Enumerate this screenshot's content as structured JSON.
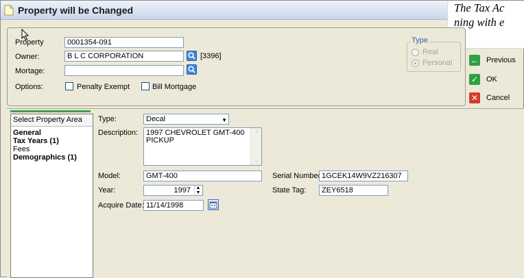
{
  "window": {
    "title": "Property will be Changed"
  },
  "caption": {
    "line1": "The Tax Ac",
    "line2": "ning with e"
  },
  "header": {
    "property_label": "Property",
    "property_value": "0001354-091",
    "owner_label": "Owner:",
    "owner_value": "B L C CORPORATION",
    "owner_code": "[3396]",
    "mortgage_label": "Mortage:",
    "mortgage_value": "",
    "options_label": "Options:",
    "penalty_exempt_label": "Penalty Exempt",
    "bill_mortgage_label": "Bill Mortgage"
  },
  "type_group": {
    "legend": "Type",
    "real_label": "Real",
    "personal_label": "Personal",
    "selected": "Personal"
  },
  "actions": {
    "previous_label": "Previous",
    "ok_label": "OK",
    "cancel_label": "Cancel"
  },
  "area_list": {
    "header": "Select Property Area",
    "items": [
      {
        "label": "General",
        "bold": true
      },
      {
        "label": "Tax Years (1)",
        "bold": true
      },
      {
        "label": "Fees",
        "bold": false
      },
      {
        "label": "Demographics (1)",
        "bold": true
      }
    ]
  },
  "detail": {
    "type_label": "Type:",
    "type_value": "Decal",
    "description_label": "Description:",
    "description_line1": "1997 CHEVROLET GMT-400",
    "description_line2": "PICKUP",
    "model_label": "Model:",
    "model_value": "GMT-400",
    "serial_label": "Serial Number:",
    "serial_value": "1GCEK14W9VZ216307",
    "year_label": "Year:",
    "year_value": "1997",
    "state_tag_label": "State Tag:",
    "state_tag_value": "ZEY6518",
    "acquire_date_label": "Acquire Date:",
    "acquire_date_value": "11/14/1998"
  },
  "colors": {
    "previous_icon": "#2fa045",
    "ok_icon": "#2fa045",
    "cancel_icon": "#d83a2a",
    "search_button": "#3d86e0"
  }
}
